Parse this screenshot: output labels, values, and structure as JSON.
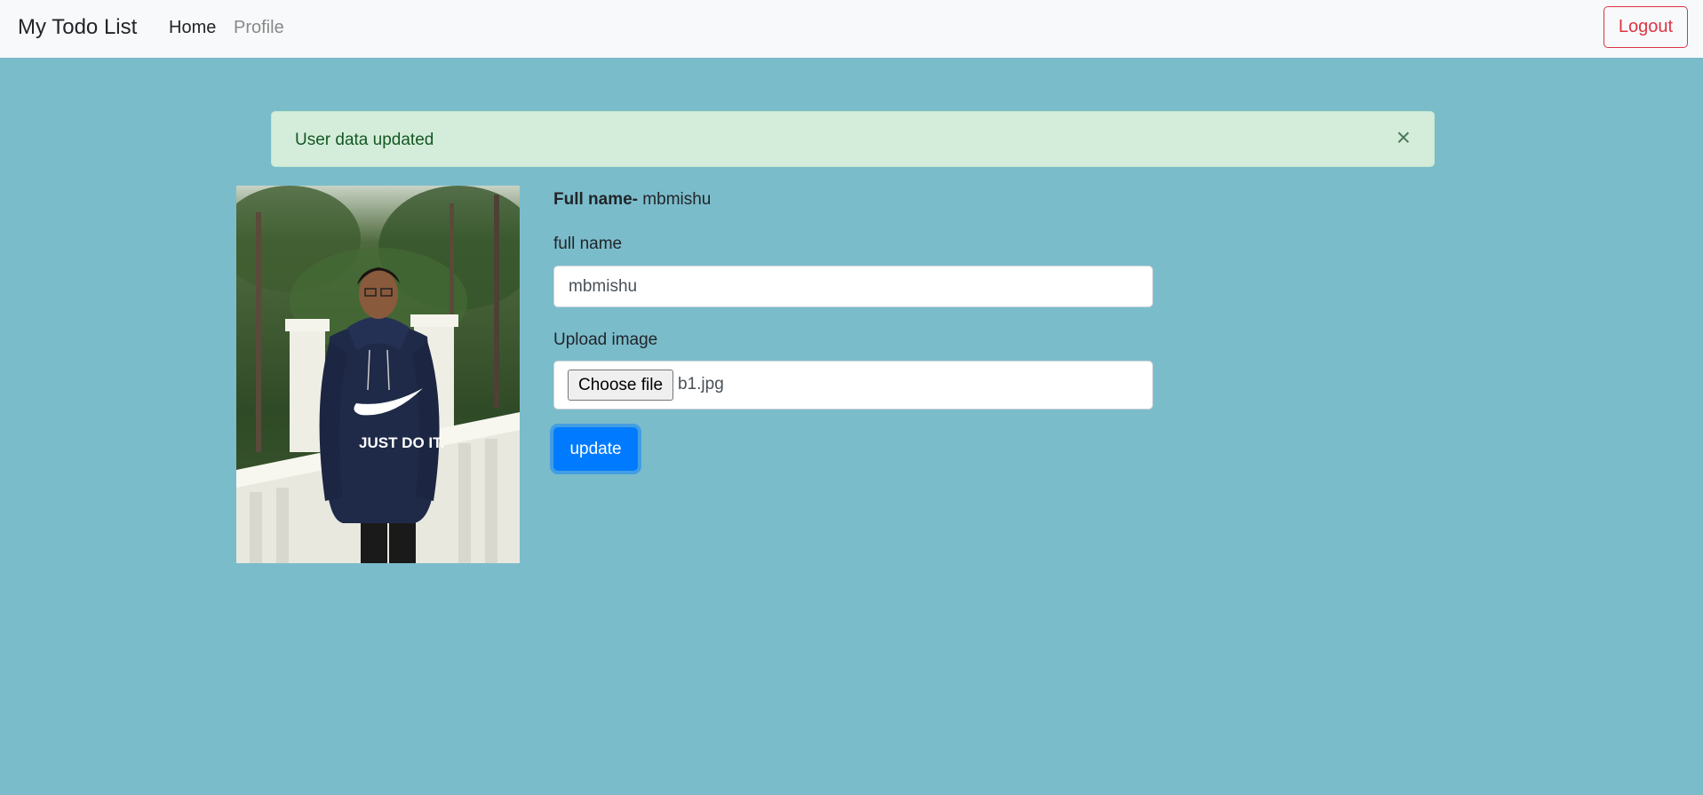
{
  "navbar": {
    "brand": "My Todo List",
    "links": [
      {
        "label": "Home"
      },
      {
        "label": "Profile"
      }
    ],
    "logout_label": "Logout"
  },
  "alert": {
    "message": "User data updated",
    "close_symbol": "×",
    "color": "#d4edda"
  },
  "profile": {
    "full_name_label": "Full name-",
    "full_name_value": "mbmishu",
    "photo_shirt_text": "JUST DO IT."
  },
  "form": {
    "name_label": "full name",
    "name_value": "mbmishu",
    "upload_label": "Upload image",
    "choose_file_label": "Choose file",
    "file_name": "b1.jpg",
    "submit_label": "update"
  },
  "colors": {
    "background": "#7bbccb",
    "primary": "#007bff",
    "danger": "#dc3545",
    "navbar": "#f8f9fa"
  },
  "icons": {
    "alert_close": "close-icon",
    "photo": "profile-photo"
  }
}
